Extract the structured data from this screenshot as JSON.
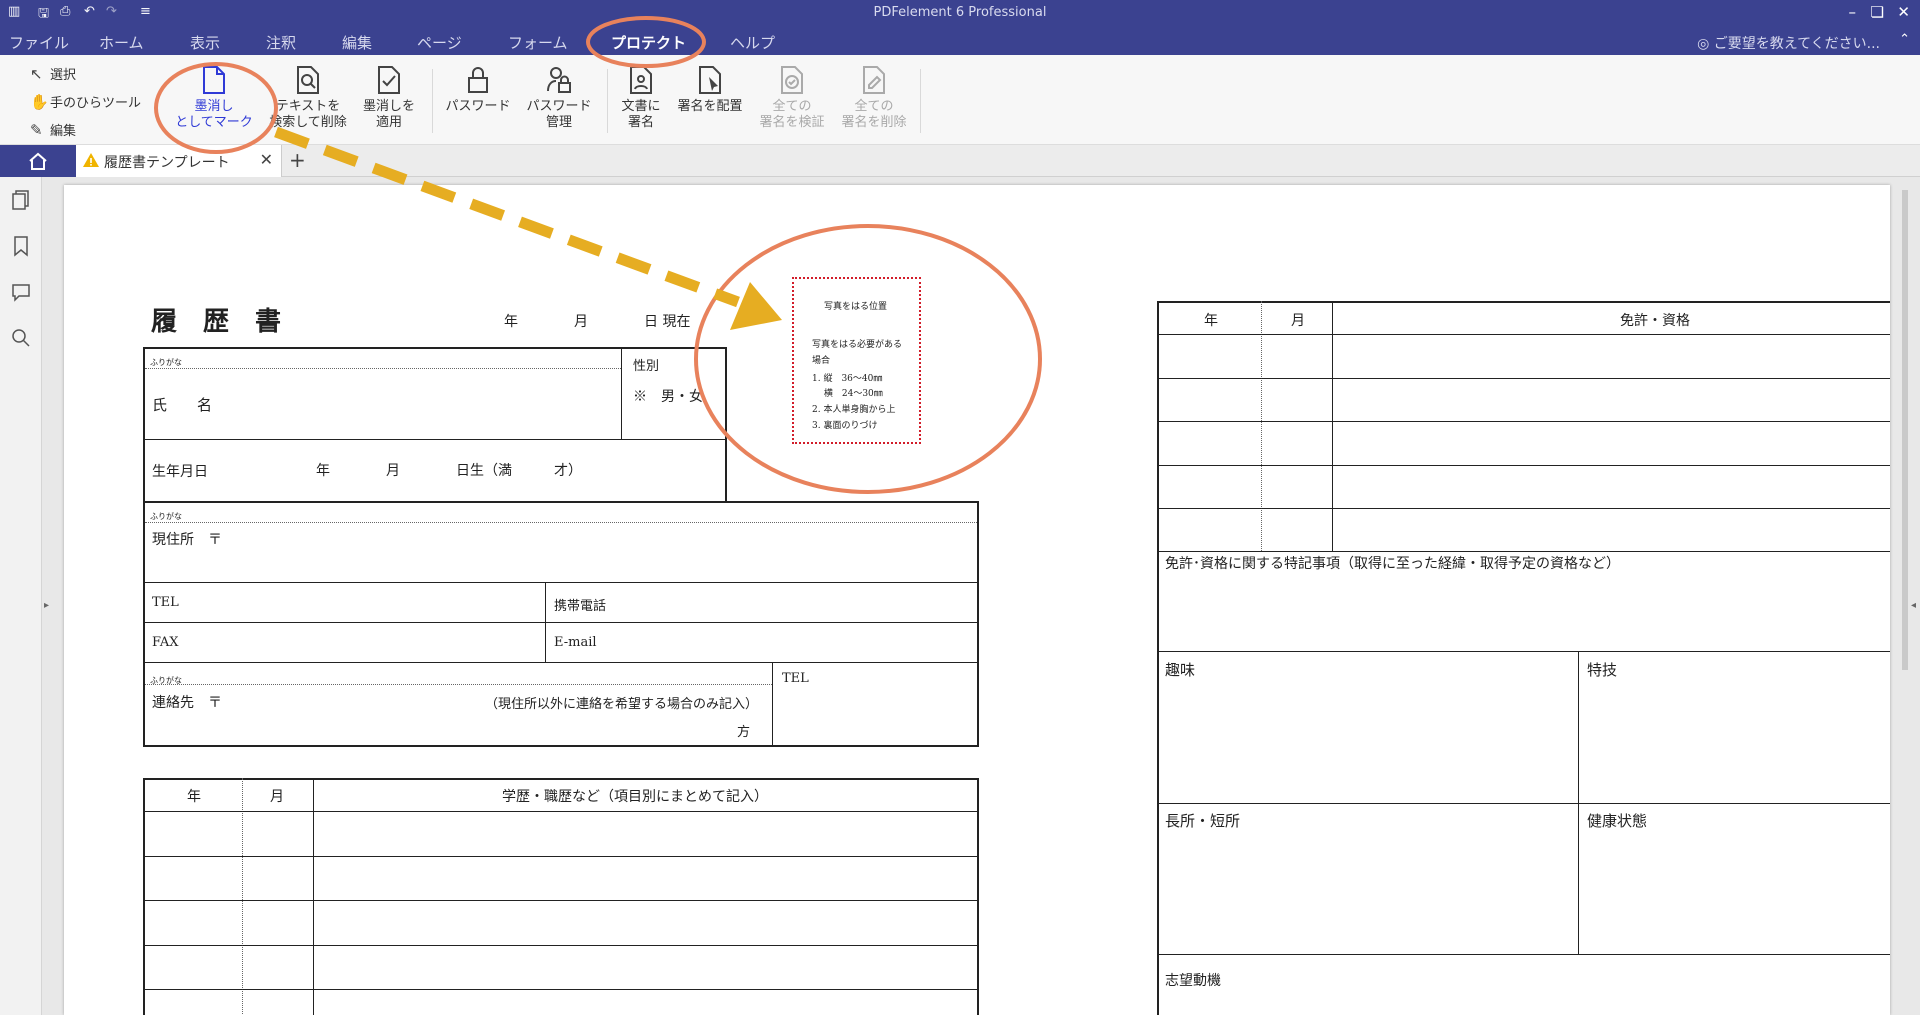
{
  "app": {
    "title": "PDFelement 6 Professional",
    "menu": [
      "ファイル",
      "ホーム",
      "表示",
      "注釈",
      "編集",
      "ページ",
      "フォーム",
      "プロテクト",
      "ヘルプ"
    ],
    "active_menu": "プロテクト",
    "help_hint": "ご要望を教えてください..."
  },
  "ribbon": {
    "tools": [
      "選択",
      "手のひらツール",
      "編集"
    ],
    "buttons": [
      {
        "line1": "墨消し",
        "line2": "としてマーク",
        "icon": "page-icon"
      },
      {
        "line1": "テキストを",
        "line2": "検索して削除",
        "icon": "search-page-icon"
      },
      {
        "line1": "墨消しを",
        "line2": "適用",
        "icon": "check-page-icon"
      },
      {
        "line1": "パスワード",
        "line2": "",
        "icon": "lock-icon"
      },
      {
        "line1": "パスワード",
        "line2": "管理",
        "icon": "user-lock-icon"
      },
      {
        "line1": "文書に",
        "line2": "署名",
        "icon": "sign-doc-icon"
      },
      {
        "line1": "署名を配置",
        "line2": "",
        "icon": "place-sign-icon"
      },
      {
        "line1": "全ての",
        "line2": "署名を検証",
        "icon": "verify-icon"
      },
      {
        "line1": "全ての",
        "line2": "署名を削除",
        "icon": "delete-sign-icon"
      }
    ]
  },
  "tab": {
    "name": "履歴書テンプレート"
  },
  "resume": {
    "title": "履　歴　書",
    "date_line": "年　　　　月　　　　日 現在",
    "furigana": "ふりがな",
    "name_label": "氏　　名",
    "gender_label": "性別",
    "gender_value": "※　男・女",
    "birth_label": "生年月日",
    "birth_fields": "年　　　　月　　　　日生（満　　　才）",
    "address_label": "現住所　〒",
    "tel": "TEL",
    "mobile": "携帯電話",
    "fax": "FAX",
    "email": "E-mail",
    "contact_label": "連絡先　〒",
    "contact_note": "（現住所以外に連絡を希望する場合のみ記入）",
    "contact_suffix": "方",
    "contact_tel": "TEL",
    "edu_year": "年",
    "edu_month": "月",
    "edu_header": "学歴・職歴など（項目別にまとめて記入）",
    "photo": {
      "title": "写真をはる位置",
      "line1": "写真をはる必要がある",
      "line2": "場合",
      "line3": "1. 縦　36〜40㎜",
      "line4": "　 横　24〜30㎜",
      "line5": "2. 本人単身胸から上",
      "line6": "3. 裏面のりづけ"
    },
    "lic_year": "年",
    "lic_month": "月",
    "lic_header": "免許・資格",
    "lic_note": "免許･資格に関する特記事項（取得に至った経緯・取得予定の資格など）",
    "hobby": "趣味",
    "skill": "特技",
    "strength": "長所・短所",
    "health": "健康状態",
    "motivation": "志望動機"
  }
}
